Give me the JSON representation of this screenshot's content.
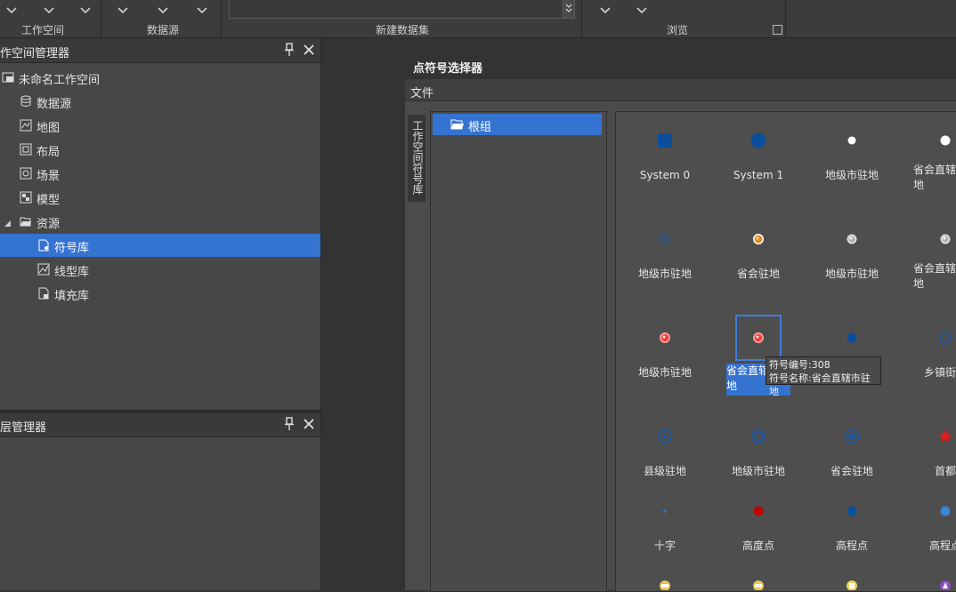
{
  "ribbon": {
    "groups": [
      {
        "label": "工作空间"
      },
      {
        "label": "数据源"
      },
      {
        "label": "新建数据集"
      },
      {
        "label": "浏览"
      }
    ]
  },
  "workspace_panel": {
    "title": "作空间管理器",
    "items": [
      {
        "label": "未命名工作空间"
      },
      {
        "label": "数据源"
      },
      {
        "label": "地图"
      },
      {
        "label": "布局"
      },
      {
        "label": "场景"
      },
      {
        "label": "模型"
      },
      {
        "label": "资源"
      },
      {
        "label": "符号库"
      },
      {
        "label": "线型库"
      },
      {
        "label": "填充库"
      }
    ]
  },
  "layer_panel": {
    "title": "层管理器"
  },
  "dialog": {
    "title": "点符号选择器",
    "menu_file": "文件",
    "side_tab": "工作空间符号库",
    "tree_root": "根组",
    "symbols": [
      {
        "label": "System 0",
        "icon": "square-blue"
      },
      {
        "label": "System 1",
        "icon": "circle-blue"
      },
      {
        "label": "地级市驻地",
        "icon": "dot-white"
      },
      {
        "label": "省会直辖市驻地",
        "icon": "dot-white-large"
      },
      {
        "label": "地级市驻地",
        "icon": "ring-blue-small"
      },
      {
        "label": "省会驻地",
        "icon": "dot-orange-glow"
      },
      {
        "label": "地级市驻地",
        "icon": "dot-grey-glow"
      },
      {
        "label": "省会直辖市驻地",
        "icon": "dot-grey-glow"
      },
      {
        "label": "地级市驻地",
        "icon": "dot-red-glow"
      },
      {
        "label": "省会直辖市驻地",
        "icon": "dot-red-glow"
      },
      {
        "label": "",
        "icon": "dot-blue"
      },
      {
        "label": "乡镇街道",
        "icon": "ring-blue"
      },
      {
        "label": "县级驻地",
        "icon": "ring-dot-blue"
      },
      {
        "label": "地级市驻地",
        "icon": "ring-double-blue"
      },
      {
        "label": "省会驻地",
        "icon": "ring-dot-blue-large"
      },
      {
        "label": "首都",
        "icon": "star-red"
      },
      {
        "label": "十字",
        "icon": "cross-blue"
      },
      {
        "label": "高度点",
        "icon": "dot-darkred"
      },
      {
        "label": "高程点",
        "icon": "dot-blue"
      },
      {
        "label": "高程点",
        "icon": "dot-lightblue"
      }
    ],
    "tooltip": {
      "line1": "符号编号:308",
      "line2": "符号名称:省会直辖市驻地"
    }
  },
  "colors": {
    "accent": "#3573d1",
    "symbol_blue": "#0b4f9c"
  }
}
